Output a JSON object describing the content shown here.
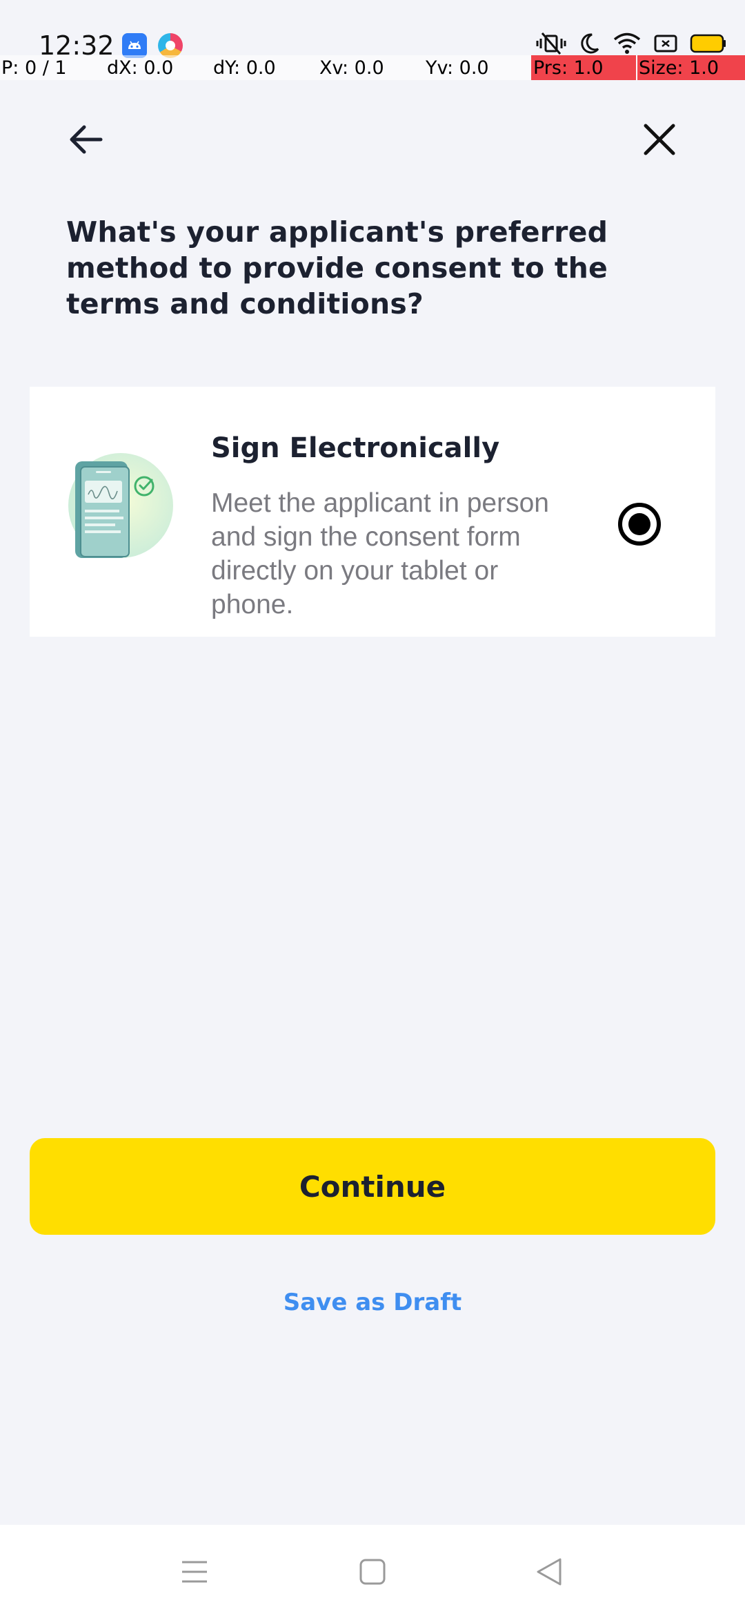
{
  "status_bar": {
    "time": "12:32",
    "left_icons": [
      "android-app-icon",
      "browser-app-icon"
    ],
    "right_icons": [
      "vibrate-icon",
      "do-not-disturb-moon-icon",
      "wifi-icon",
      "sim-icon",
      "battery-icon"
    ],
    "battery_color": "#ffcc00"
  },
  "debug_overlay": {
    "pointer": "P: 0 / 1",
    "dx": "dX: 0.0",
    "dy": "dY: 0.0",
    "xv": "Xv: 0.0",
    "yv": "Yv: 0.0",
    "pressure": "Prs: 1.0",
    "size": "Size: 1.0"
  },
  "header": {
    "back_icon": "arrow-left-icon",
    "close_icon": "close-icon"
  },
  "question": "What's your applicant's preferred method to provide consent to the terms and conditions?",
  "option": {
    "title": "Sign Electronically",
    "description": "Meet the applicant in person and sign the consent form directly on your tablet or phone.",
    "illustration": "phone-signature-illustration",
    "selected": true
  },
  "actions": {
    "continue_label": "Continue",
    "save_draft_label": "Save as Draft"
  },
  "colors": {
    "background": "#f3f4f9",
    "primary_button": "#ffde00",
    "link": "#3f8ef0",
    "debug_highlight": "#f0434b"
  },
  "system_nav": {
    "icons": [
      "menu-icon",
      "home-icon",
      "back-triangle-icon"
    ]
  }
}
